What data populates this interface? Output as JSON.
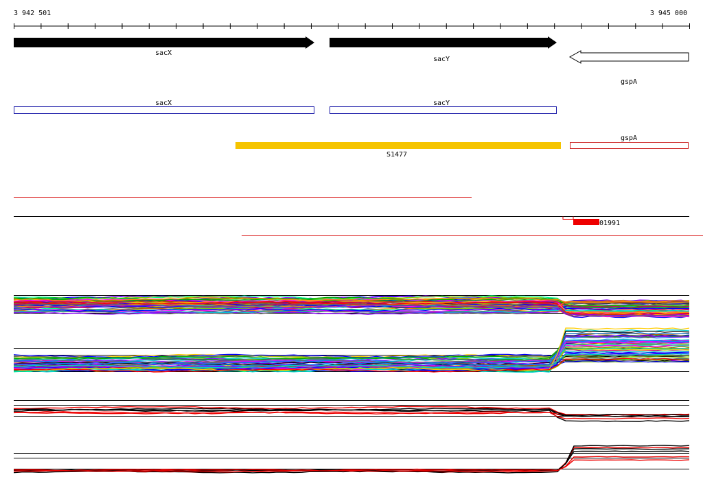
{
  "ruler": {
    "start_label": "3 942 501",
    "end_label": "3 945 000"
  },
  "genes": [
    {
      "name": "sacX",
      "strand": "+",
      "style": "filled",
      "color": "#000000"
    },
    {
      "name": "sacY",
      "strand": "+",
      "style": "filled",
      "color": "#000000"
    },
    {
      "name": "gspA",
      "strand": "-",
      "style": "outline",
      "color": "#000000"
    }
  ],
  "cds_boxes": [
    {
      "name": "sacX",
      "color": "#1a1aa8"
    },
    {
      "name": "sacY",
      "color": "#1a1aa8"
    }
  ],
  "regulatory": {
    "segment": {
      "name": "S1477",
      "color": "#f5c400"
    },
    "gspA_box": {
      "name": "gspA",
      "color": "#cc2222"
    }
  },
  "transcripts": {
    "marker_label": "01991",
    "line_color": "#dd3333",
    "marker_color": "#ee0000"
  },
  "expression_tracks": {
    "palette": [
      "#000000",
      "#ff0000",
      "#00aa00",
      "#0000ff",
      "#ff00ff",
      "#00cccc",
      "#ff8800",
      "#8800ff",
      "#88cc00",
      "#cc0066",
      "#0088ff",
      "#aa5500",
      "#ffcc00",
      "#00ff88",
      "#666666"
    ]
  }
}
